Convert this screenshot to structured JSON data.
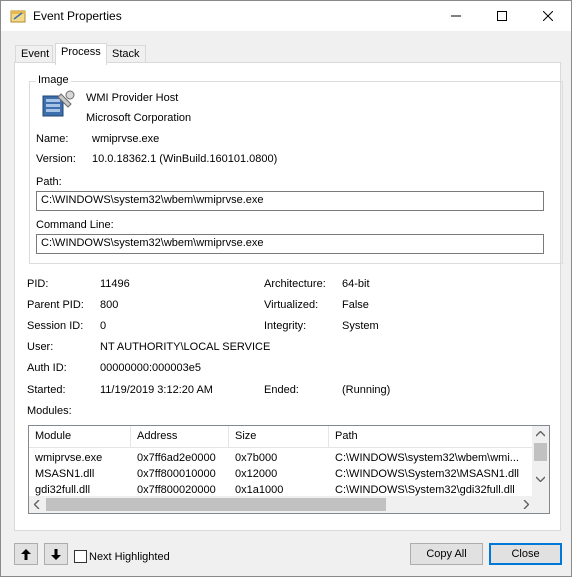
{
  "window": {
    "title": "Event Properties"
  },
  "tabs": [
    {
      "label": "Event"
    },
    {
      "label": "Process"
    },
    {
      "label": "Stack"
    }
  ],
  "image_group": {
    "label": "Image",
    "description": "WMI Provider Host",
    "company": "Microsoft Corporation",
    "name_label": "Name:",
    "name": "wmiprvse.exe",
    "version_label": "Version:",
    "version": "10.0.18362.1 (WinBuild.160101.0800)",
    "path_label": "Path:",
    "path": "C:\\WINDOWS\\system32\\wbem\\wmiprvse.exe",
    "cmdline_label": "Command Line:",
    "cmdline": "C:\\WINDOWS\\system32\\wbem\\wmiprvse.exe"
  },
  "details": {
    "pid_label": "PID:",
    "pid": "11496",
    "ppid_label": "Parent PID:",
    "ppid": "800",
    "session_label": "Session ID:",
    "session": "0",
    "user_label": "User:",
    "user": "NT AUTHORITY\\LOCAL SERVICE",
    "authid_label": "Auth ID:",
    "authid": "00000000:000003e5",
    "started_label": "Started:",
    "started": "11/19/2019 3:12:20 AM",
    "arch_label": "Architecture:",
    "arch": "64-bit",
    "virt_label": "Virtualized:",
    "virt": "False",
    "integrity_label": "Integrity:",
    "integrity": "System",
    "ended_label": "Ended:",
    "ended": "(Running)",
    "modules_label": "Modules:"
  },
  "modules": {
    "columns": [
      "Module",
      "Address",
      "Size",
      "Path"
    ],
    "rows": [
      [
        "wmiprvse.exe",
        "0x7ff6ad2e0000",
        "0x7b000",
        "C:\\WINDOWS\\system32\\wbem\\wmi..."
      ],
      [
        "MSASN1.dll",
        "0x7ff800010000",
        "0x12000",
        "C:\\WINDOWS\\System32\\MSASN1.dll"
      ],
      [
        "gdi32full.dll",
        "0x7ff800020000",
        "0x1a1000",
        "C:\\WINDOWS\\System32\\gdi32full.dll"
      ]
    ]
  },
  "footer": {
    "up_icon": "arrow-up-icon",
    "down_icon": "arrow-down-icon",
    "next_highlighted_label": "Next Highlighted",
    "next_highlighted_checked": false,
    "copy_all_label": "Copy All",
    "close_label": "Close"
  },
  "colors": {
    "accent": "#0078d7",
    "button_face": "#e1e1e1",
    "window_bg": "#f0f0f0"
  }
}
